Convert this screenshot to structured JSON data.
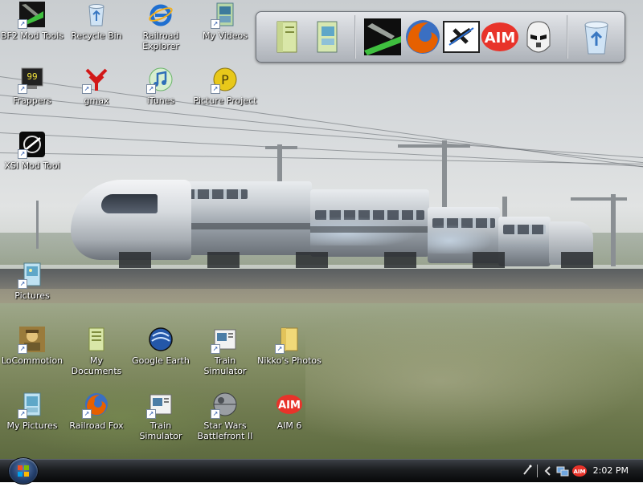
{
  "desktop": {
    "icons": [
      {
        "label": "BF2 Mod Tools",
        "icon": "bf2-mod-tools-icon"
      },
      {
        "label": "Recycle Bin",
        "icon": "recycle-bin-icon"
      },
      {
        "label": "Railroad Explorer",
        "icon": "internet-explorer-icon"
      },
      {
        "label": "My Videos",
        "icon": "my-videos-icon"
      },
      {
        "label": "Frappers",
        "icon": "fraps-icon"
      },
      {
        "label": "gmax",
        "icon": "gmax-icon"
      },
      {
        "label": "iTunes",
        "icon": "itunes-icon"
      },
      {
        "label": "Picture Project",
        "icon": "picture-project-icon"
      },
      {
        "label": "XSI Mod Tool",
        "icon": "xsi-mod-tool-icon"
      },
      {
        "label": "Pictures",
        "icon": "pictures-folder-icon"
      },
      {
        "label": "LoCommotion",
        "icon": "locomotion-icon"
      },
      {
        "label": "My Documents",
        "icon": "my-documents-icon"
      },
      {
        "label": "Google Earth",
        "icon": "google-earth-icon"
      },
      {
        "label": "Train Simulator",
        "icon": "train-simulator-icon"
      },
      {
        "label": "Nikko's Photos",
        "icon": "folder-icon"
      },
      {
        "label": "My Pictures",
        "icon": "my-pictures-icon"
      },
      {
        "label": "Railroad Fox",
        "icon": "firefox-icon"
      },
      {
        "label": "Train Simulator",
        "icon": "train-simulator-icon"
      },
      {
        "label": "Star Wars Battlefront II",
        "icon": "death-star-icon"
      },
      {
        "label": "AIM 6",
        "icon": "aim-icon"
      }
    ]
  },
  "dock": {
    "items": [
      "my-documents-icon",
      "my-pictures-icon",
      "star-destroyer-icon",
      "firefox-icon",
      "xfire-icon",
      "aim-icon",
      "clone-trooper-icon",
      "recycle-bin-icon"
    ],
    "aim_text": "AIM"
  },
  "taskbar": {
    "clock": "2:02 PM",
    "aim_text": "AIM",
    "fraps_text": "99"
  },
  "colors": {
    "label_text": "#ffffff",
    "taskbar": "#1b1d20",
    "ie_blue": "#1f6fd0",
    "firefox_orange": "#e66000",
    "aim_red": "#e8332a"
  }
}
